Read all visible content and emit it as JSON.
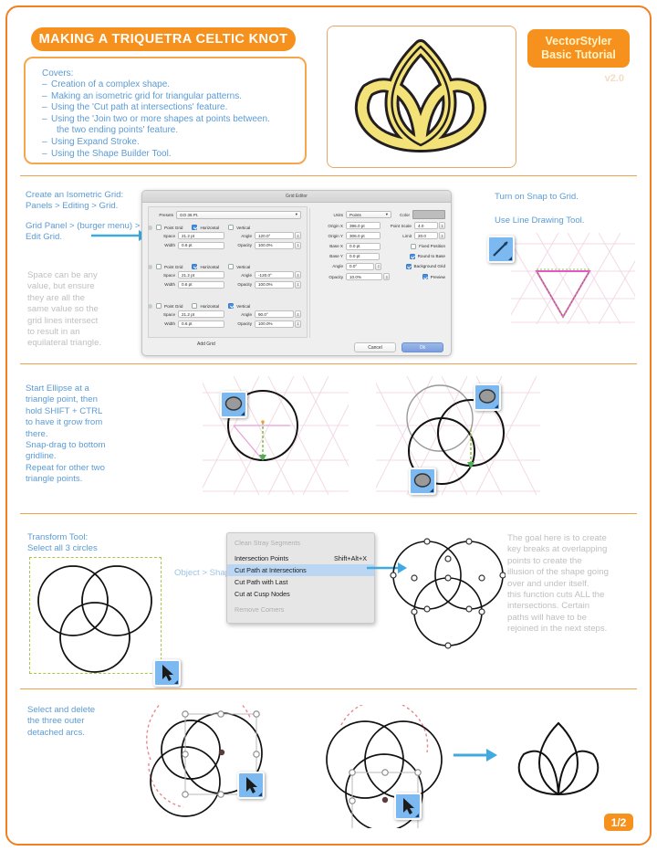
{
  "header": {
    "title": "MAKING A TRIQUETRA CELTIC KNOT",
    "covers_label": "Covers:",
    "covers_items": [
      "Creation of a complex shape.",
      "Making an isometric grid for triangular patterns.",
      "Using the 'Cut path at intersections' feature.",
      "Using the 'Join two or more shapes at points between.",
      "the two ending points' feature.",
      "Using Expand Stroke.",
      "Using the Shape Builder Tool."
    ],
    "brand_line1": "VectorStyler",
    "brand_line2": "Basic Tutorial",
    "version": "v2.0",
    "hero_icon": "triquetra-knot"
  },
  "section_grid": {
    "instr1": "Create an Isometric Grid:\nPanels > Editing > Grid.",
    "instr2": "Grid Panel > (burger menu) >\nEdit Grid.",
    "note": "Space can be any\nvalue, but ensure\nthey are all the\nsame value so the\ngrid lines intersect\nto result in an\nequilateral triangle.",
    "right_instr1": "Turn on Snap to Grid.",
    "right_instr2": "Use Line Drawing Tool.",
    "line_tool_icon": "line-drawing-tool-icon"
  },
  "grid_dialog": {
    "title": "Grid Editor",
    "preset_label": "Presets",
    "preset_value": "GO 36 Pt.",
    "rows": [
      {
        "point_grid": "Point Grid",
        "point_grid_on": false,
        "horizontal": "Horizontal",
        "horizontal_on": true,
        "vertical": "Vertical",
        "vertical_on": false,
        "space_label": "Space",
        "space_value": "21.2 pt",
        "angle_label": "Angle",
        "angle_value": "120.0°",
        "width_label": "Width",
        "width_value": "0.6 pt",
        "opacity_label": "Opacity",
        "opacity_value": "100.0%"
      },
      {
        "point_grid": "Point Grid",
        "point_grid_on": false,
        "horizontal": "Horizontal",
        "horizontal_on": true,
        "vertical": "Vertical",
        "vertical_on": false,
        "space_label": "Space",
        "space_value": "21.2 pt",
        "angle_label": "Angle",
        "angle_value": "-120.0°",
        "width_label": "Width",
        "width_value": "0.6 pt",
        "opacity_label": "Opacity",
        "opacity_value": "100.0%"
      },
      {
        "point_grid": "Point Grid",
        "point_grid_on": false,
        "horizontal": "Horizontal",
        "horizontal_on": false,
        "vertical": "Vertical",
        "vertical_on": true,
        "space_label": "Space",
        "space_value": "21.2 pt",
        "angle_label": "Angle",
        "angle_value": "90.0°",
        "width_label": "Width",
        "width_value": "0.6 pt",
        "opacity_label": "Opacity",
        "opacity_value": "100.0%"
      }
    ],
    "add_grid": "Add Grid",
    "right_fields": {
      "units_label": "Units",
      "units_value": "Points",
      "origin_x_label": "Origin X",
      "origin_x_value": "396.0 pt",
      "origin_y_label": "Origin Y",
      "origin_y_value": "306.0 pt",
      "base_x_label": "Base X",
      "base_x_value": "0.0 pt",
      "base_y_label": "Base Y",
      "base_y_value": "0.0 pt",
      "angle_label": "Angle",
      "angle_value": "0.0°",
      "opacity_label": "Opacity",
      "opacity_value": "10.0%",
      "color_label": "Color",
      "point_scale_label": "Point Scale",
      "point_scale_value": "4.0",
      "limit_label": "Limit",
      "limit_value": "20.0",
      "fixed_position": "Fixed Position",
      "fixed_position_on": false,
      "round_to_base": "Round to Base",
      "round_to_base_on": true,
      "background_grid": "Background Grid",
      "background_grid_on": true,
      "preview": "Preview",
      "preview_on": true
    },
    "cancel": "Cancel",
    "ok": "Ok"
  },
  "section_ellipse": {
    "instr": "Start Ellipse at a\ntriangle point, then\nhold SHIFT + CTRL\nto have it grow from\nthere.\nSnap-drag to bottom\ngridline.\nRepeat for other two\ntriangle points.",
    "ellipse_tool_icon": "ellipse-tool-icon"
  },
  "section_transform": {
    "instr": "Transform Tool:\nSelect all 3 circles",
    "menu_path": "Object > Shape >",
    "pointer_icon": "selection-pointer-icon",
    "menu": {
      "items": [
        {
          "label": "Clean Stray Segments",
          "shortcut": "",
          "disabled": true,
          "highlighted": false
        },
        {
          "label": "Intersection Points",
          "shortcut": "Shift+Alt+X",
          "disabled": false,
          "highlighted": false
        },
        {
          "label": "Cut Path at Intersections",
          "shortcut": "",
          "disabled": false,
          "highlighted": true
        },
        {
          "label": "Cut Path with Last",
          "shortcut": "",
          "disabled": false,
          "highlighted": false
        },
        {
          "label": "Cut at Cusp Nodes",
          "shortcut": "",
          "disabled": false,
          "highlighted": false
        },
        {
          "label": "Remove Corners",
          "shortcut": "",
          "disabled": true,
          "highlighted": false
        }
      ]
    },
    "goal_note": "The goal here is to create\nkey breaks at overlapping\npoints to create the\nillusion of the shape going\nover and under itself.\nthis function cuts ALL the\nintersections.  Certain\npaths will have to be\nrejoined in the next steps."
  },
  "section_delete": {
    "instr": "Select and delete\nthe three outer\ndetached arcs.",
    "pointer_icon": "selection-pointer-icon",
    "result_icon": "triquetra-outline"
  },
  "footer": {
    "page": "1/2"
  },
  "colors": {
    "orange": "#F7911E",
    "orange_border": "#F2A24C",
    "blue_text": "#5B9BD5",
    "gray_text": "#BFBFBF",
    "arrow_blue": "#3FA9E0",
    "knot_fill": "#F2E277",
    "menu_highlight": "#BBD6F2"
  }
}
